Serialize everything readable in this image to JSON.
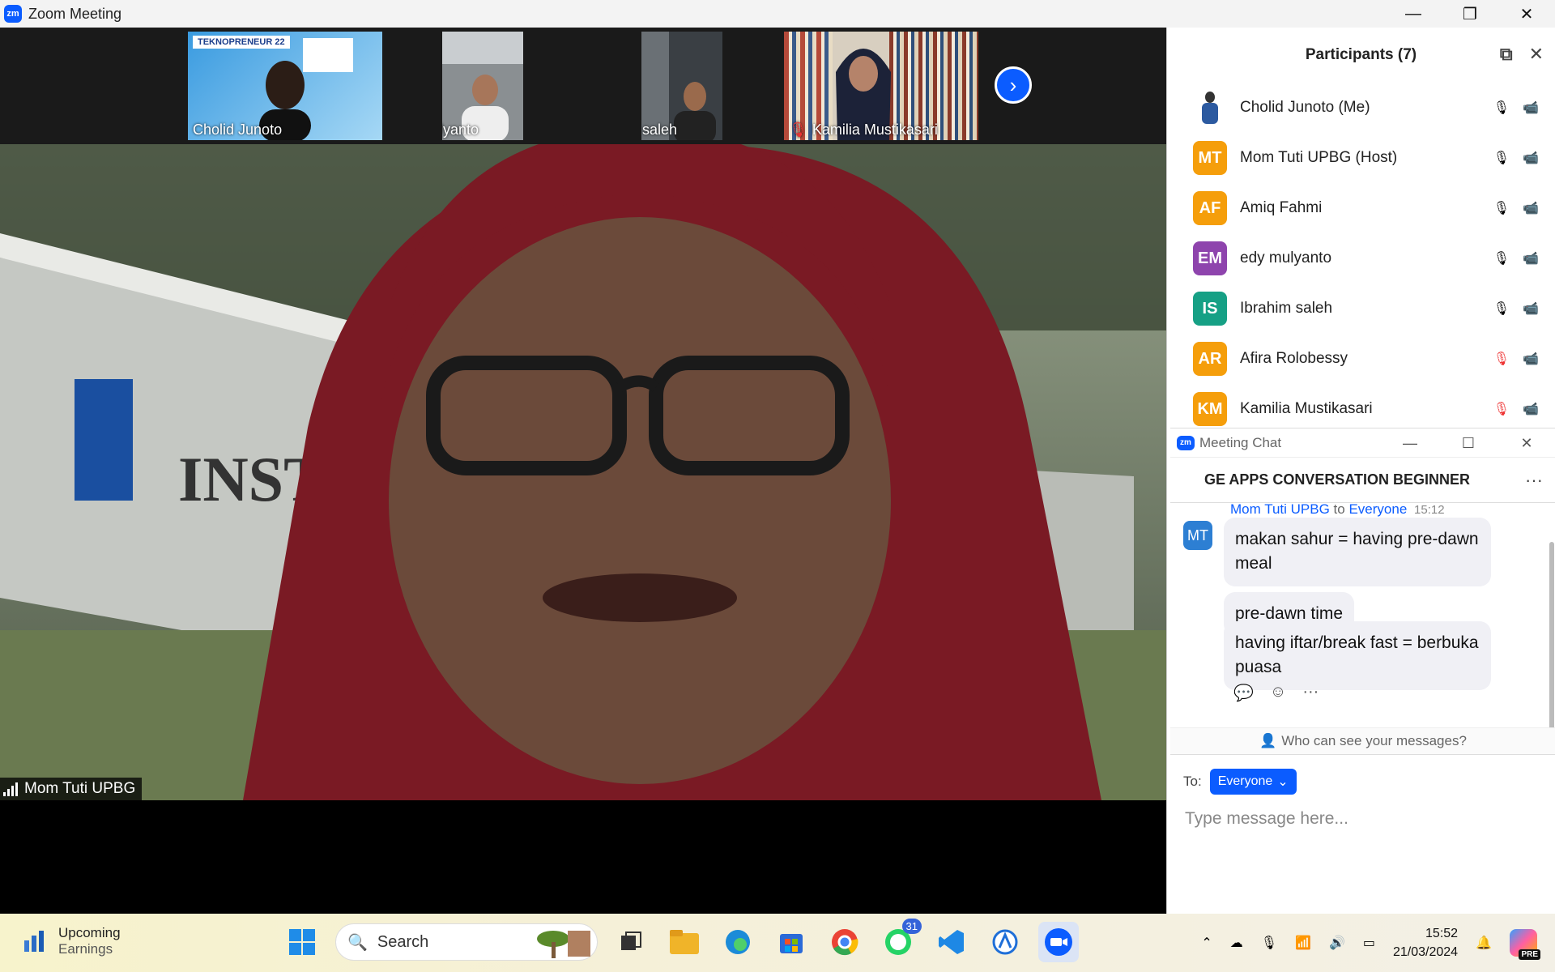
{
  "window": {
    "title": "Zoom Meeting",
    "logo_text": "zm",
    "controls": [
      "—",
      "❐",
      "✕"
    ]
  },
  "video_strip": {
    "tiles": [
      {
        "name": "Cholid Junoto",
        "banner": "TEKNOPRENEUR 22",
        "muted": false
      },
      {
        "name": "edy mulyanto",
        "muted": false
      },
      {
        "name": "Ibrahim saleh",
        "muted": false
      },
      {
        "name": "Kamilia Mustikasari",
        "muted": true
      }
    ],
    "next_arrow": "›"
  },
  "main_video": {
    "speaker": "Mom Tuti UPBG",
    "sign_text": "INSTITUT"
  },
  "participants": {
    "title": "Participants (7)",
    "list": [
      {
        "initials": "",
        "name": "Cholid Junoto (Me)",
        "color": "#2c5aa0",
        "mic": "on"
      },
      {
        "initials": "MT",
        "name": "Mom Tuti UPBG (Host)",
        "color": "#f59e0b",
        "mic": "on"
      },
      {
        "initials": "AF",
        "name": "Amiq Fahmi",
        "color": "#f59e0b",
        "mic": "on"
      },
      {
        "initials": "EM",
        "name": "edy mulyanto",
        "color": "#8e44ad",
        "mic": "on"
      },
      {
        "initials": "IS",
        "name": "Ibrahim saleh",
        "color": "#16a085",
        "mic": "on"
      },
      {
        "initials": "AR",
        "name": "Afira Rolobessy",
        "color": "#f59e0b",
        "mic": "muted"
      },
      {
        "initials": "KM",
        "name": "Kamilia Mustikasari",
        "color": "#f59e0b",
        "mic": "muted"
      }
    ]
  },
  "chat": {
    "window_title": "Meeting Chat",
    "window_controls": [
      "—",
      "☐",
      "✕"
    ],
    "group_name": "GE APPS CONVERSATION BEGINNER",
    "menu": "···",
    "sender": "Mom Tuti UPBG",
    "to_word": "to",
    "recipient": "Everyone",
    "time": "15:12",
    "avatar": "MT",
    "messages": [
      "makan sahur = having pre-dawn meal",
      "pre-dawn time",
      "having iftar/break fast = berbuka puasa"
    ],
    "reactions": [
      "💬",
      "☺",
      "···"
    ],
    "visibility": "Who can see your messages?",
    "to_label": "To:",
    "to_value": "Everyone",
    "placeholder": "Type message here..."
  },
  "taskbar": {
    "weather_title": "Upcoming",
    "weather_sub": "Earnings",
    "search": "Search",
    "whatsapp_badge": "31",
    "time": "15:52",
    "date": "21/03/2024",
    "copilot_badge": "PRE"
  }
}
